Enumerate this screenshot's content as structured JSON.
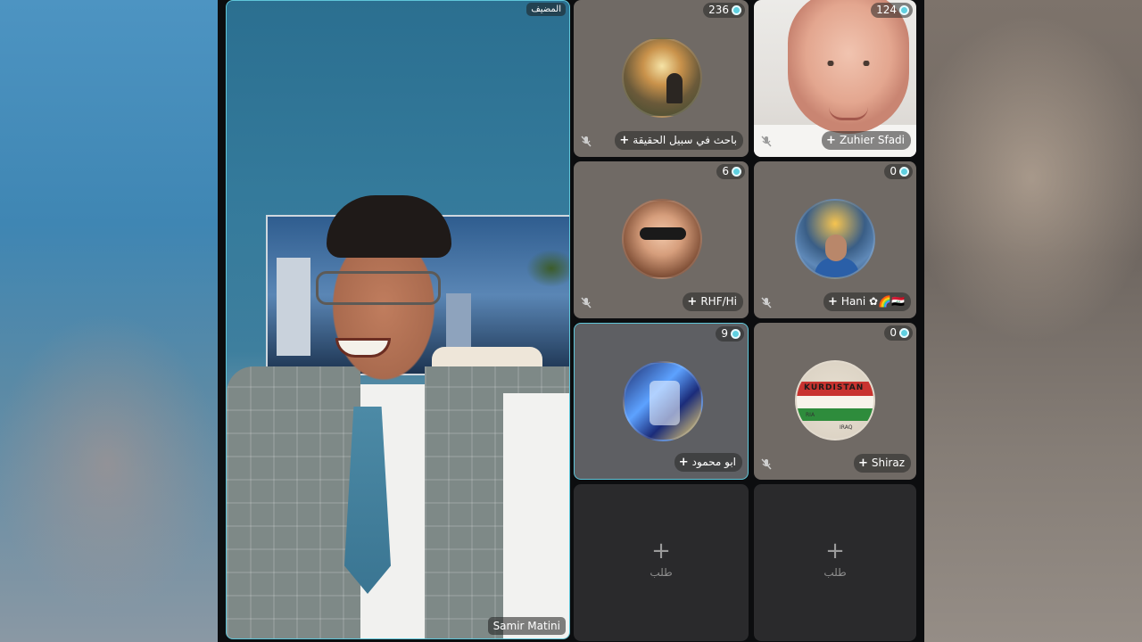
{
  "host": {
    "role_badge": "المضيف",
    "name": "Samir Matini"
  },
  "participants": [
    {
      "name": "باحث في سبيل الحقيقة",
      "viewers": "236",
      "avatar": "landscape-avatar"
    },
    {
      "name": "Zuhier Sfadi",
      "viewers": "124",
      "avatar": "camera-feed"
    },
    {
      "name": "RHF/Hi",
      "viewers": "6",
      "avatar": "sunglasses-avatar"
    },
    {
      "name": "Hani ✿🌈🇮🇶",
      "viewers": "0",
      "avatar": "portrait-avatar"
    },
    {
      "name": "ابو محمود",
      "viewers": "9",
      "avatar": "blue-graphic-avatar"
    },
    {
      "name": "Shiraz",
      "viewers": "0",
      "avatar": "kurdistan-map-avatar"
    }
  ],
  "avatar_text": {
    "flag": "KURDISTAN",
    "map_label_1": "RIA",
    "map_label_2": "IRAQ"
  },
  "empty_slots": [
    {
      "plus": "+",
      "label": "طلب"
    },
    {
      "plus": "+",
      "label": "طلب"
    }
  ],
  "colors": {
    "accent": "#5fc6d9",
    "tile": "#706a65",
    "empty_tile": "#2a2a2c",
    "background": "#0c0d0f"
  }
}
